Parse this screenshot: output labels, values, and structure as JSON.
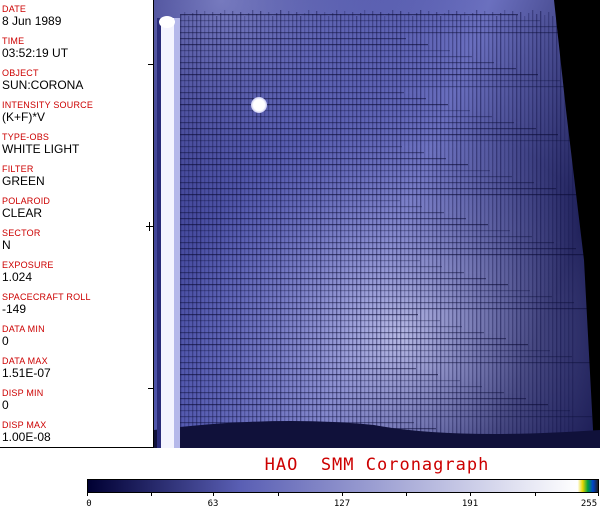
{
  "fields": [
    {
      "label": "DATE",
      "value": "8 Jun 1989"
    },
    {
      "label": "TIME",
      "value": "03:52:19 UT"
    },
    {
      "label": "OBJECT",
      "value": "SUN:CORONA"
    },
    {
      "label": "INTENSITY SOURCE",
      "value": "(K+F)*V"
    },
    {
      "label": "TYPE-OBS",
      "value": "WHITE LIGHT"
    },
    {
      "label": "FILTER",
      "value": "GREEN"
    },
    {
      "label": "POLAROID",
      "value": "CLEAR"
    },
    {
      "label": "SECTOR",
      "value": "N"
    },
    {
      "label": "EXPOSURE",
      "value": "1.024"
    },
    {
      "label": "SPACECRAFT ROLL",
      "value": "-149"
    },
    {
      "label": "DATA MIN",
      "value": "0"
    },
    {
      "label": "DATA MAX",
      "value": "1.51E-07"
    },
    {
      "label": "DISP MIN",
      "value": "0"
    },
    {
      "label": "DISP MAX",
      "value": "1.00E-08"
    }
  ],
  "title": "HAO  SMM Coronagraph",
  "colorbar": {
    "labels": [
      "0",
      "63",
      "127",
      "191",
      "255"
    ],
    "tick_values": [
      0,
      32,
      63,
      95,
      127,
      159,
      191,
      223,
      255
    ],
    "label_values": [
      0,
      63,
      127,
      191,
      255
    ],
    "max": 255
  },
  "colors": {
    "label_red": "#cc0000",
    "colormap_dark": "#000033",
    "colormap_mid": "#5a5fb4",
    "colormap_light": "#ffffff"
  }
}
